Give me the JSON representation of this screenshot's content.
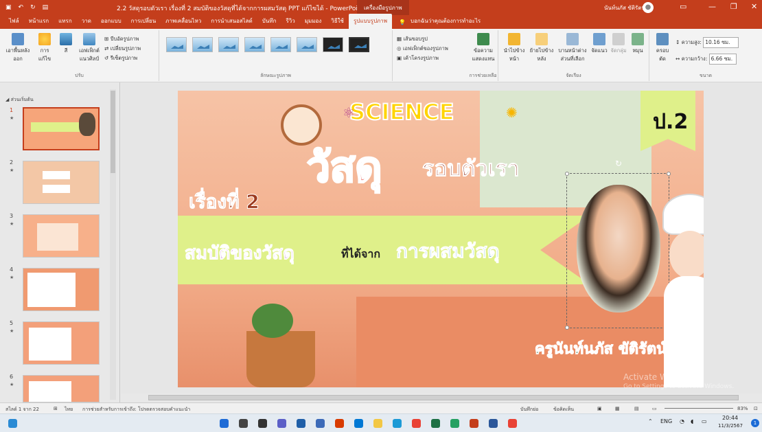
{
  "titlebar": {
    "title": "2.2 วัสดุรอบตัวเรา เรื่องที่ 2 สมบัติของวัสดุที่ได้จากการผสมวัสดุ PPT แก้ไขได้ - PowerPoint",
    "context_tab": "เครื่องมือรูปภาพ",
    "user": "นันท์นภัส ขัติรัตน์"
  },
  "tabs": {
    "items": [
      "ไฟล์",
      "หน้าแรก",
      "แทรก",
      "วาด",
      "ออกแบบ",
      "การเปลี่ยน",
      "ภาพเคลื่อนไหว",
      "การนำเสนอสไลด์",
      "บันทึก",
      "รีวิว",
      "มุมมอง",
      "วิธีใช้",
      "รูปแบบรูปภาพ"
    ],
    "tell_me": "บอกฉันว่าคุณต้องการทำอะไร"
  },
  "ribbon": {
    "remove_bg": "เอาพื้นหลังออก",
    "corrections": "การแก้ไข",
    "color": "สี",
    "artistic": "เอฟเฟ็กต์แนวศิลป์",
    "compress": "บีบอัดรูปภาพ",
    "change": "เปลี่ยนรูปภาพ",
    "reset": "รีเซ็ตรูปภาพ",
    "adjust_label": "ปรับ",
    "styles_label": "ลักษณะรูปภาพ",
    "border": "เส้นขอบรูป",
    "effects": "เอฟเฟ็กต์ของรูปภาพ",
    "layout": "เค้าโครงรูปภาพ",
    "alt_text": "ข้อความแสดงแทน",
    "access_label": "การช่วยเหลือ",
    "bring_forward": "นำไปข้างหน้า",
    "send_backward": "ย้ายไปข้างหลัง",
    "selection_pane": "บานหน้าต่างส่วนที่เลือก",
    "align": "จัดแนว",
    "group": "จัดกลุ่ม",
    "rotate": "หมุน",
    "arrange_label": "จัดเรียง",
    "crop": "ครอบตัด",
    "height_label": "ความสูง:",
    "height_value": "10.16 ซม.",
    "width_label": "ความกว้าง:",
    "width_value": "6.66 ซม.",
    "size_label": "ขนาด"
  },
  "sidebar": {
    "section": "ส่วนเริ่มต้น",
    "slides": [
      {
        "num": "1"
      },
      {
        "num": "2"
      },
      {
        "num": "3"
      },
      {
        "num": "4"
      },
      {
        "num": "5"
      },
      {
        "num": "6"
      }
    ]
  },
  "slide": {
    "science": "SCIENCE",
    "grade": "ป.2",
    "main_title": "วัสดุ",
    "main_title_2": "รอบตัวเรา",
    "topic": "เรื่องที่ 2",
    "subtitle_a": "สมบัติของวัสดุ",
    "subtitle_b": "ที่ได้จาก",
    "subtitle_c": "การผสมวัสดุ",
    "teacher": "ครูนันท์นภัส ขัติรัตน์"
  },
  "statusbar": {
    "slide_count": "สไลด์ 1 จาก 22",
    "language": "ไทย",
    "accessibility": "การช่วยสำหรับการเข้าถึง: โปรดตรวจสอบคำแนะนำ",
    "notes": "บันทึกย่อ",
    "comments": "ข้อคิดเห็น",
    "zoom": "83%"
  },
  "watermark": {
    "line1": "Activate Windows",
    "line2": "Go to Settings to activate Windows."
  },
  "taskbar": {
    "lang": "ENG",
    "time": "20:44",
    "date": "11/3/2567",
    "notif": "1"
  },
  "colors": {
    "accent": "#c43e1c",
    "slide_bg": "#f0b596",
    "banner": "#dff08a"
  }
}
